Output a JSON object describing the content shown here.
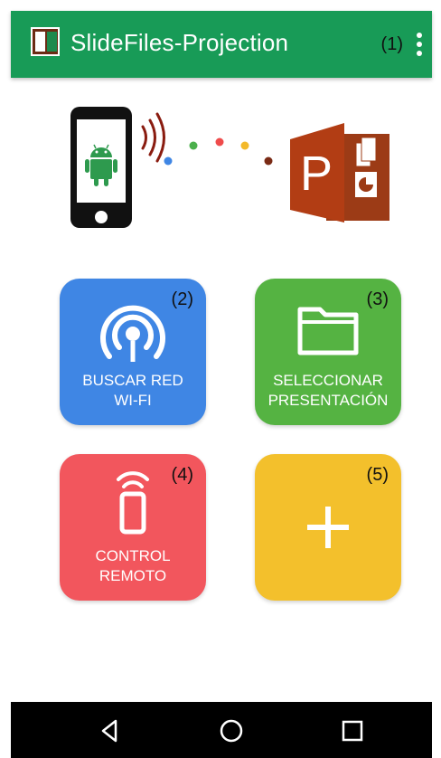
{
  "app": {
    "title": "SlideFiles-Projection",
    "menu_marker": "(1)",
    "icons": [
      "app-logo-icon",
      "overflow-menu-icon"
    ]
  },
  "illustration": {
    "icons": [
      "android-phone-icon",
      "signal-waves-icon",
      "connection-dots-icon",
      "powerpoint-icon"
    ]
  },
  "tiles": [
    {
      "label": "BUSCAR RED\nWI-FI",
      "label_line1": "BUSCAR RED",
      "label_line2": "WI-FI",
      "marker": "(2)",
      "icon": "wifi-broadcast-icon",
      "color": "#3f86e4"
    },
    {
      "label_line1": "SELECCIONAR",
      "label_line2": "PRESENTACIÓN",
      "marker": "(3)",
      "icon": "folder-icon",
      "color": "#55b342"
    },
    {
      "label_line1": "CONTROL",
      "label_line2": "REMOTO",
      "marker": "(4)",
      "icon": "remote-control-icon",
      "color": "#f2565d"
    },
    {
      "label_line1": "",
      "label_line2": "",
      "marker": "(5)",
      "icon": "plus-icon",
      "color": "#f3c02c"
    }
  ],
  "navigation": {
    "buttons": [
      "back-icon",
      "home-icon",
      "recents-icon"
    ]
  },
  "colors": {
    "appbar": "#189b57",
    "background": "#ffffff",
    "navbar": "#000000",
    "powerpoint": "#b23d14"
  }
}
